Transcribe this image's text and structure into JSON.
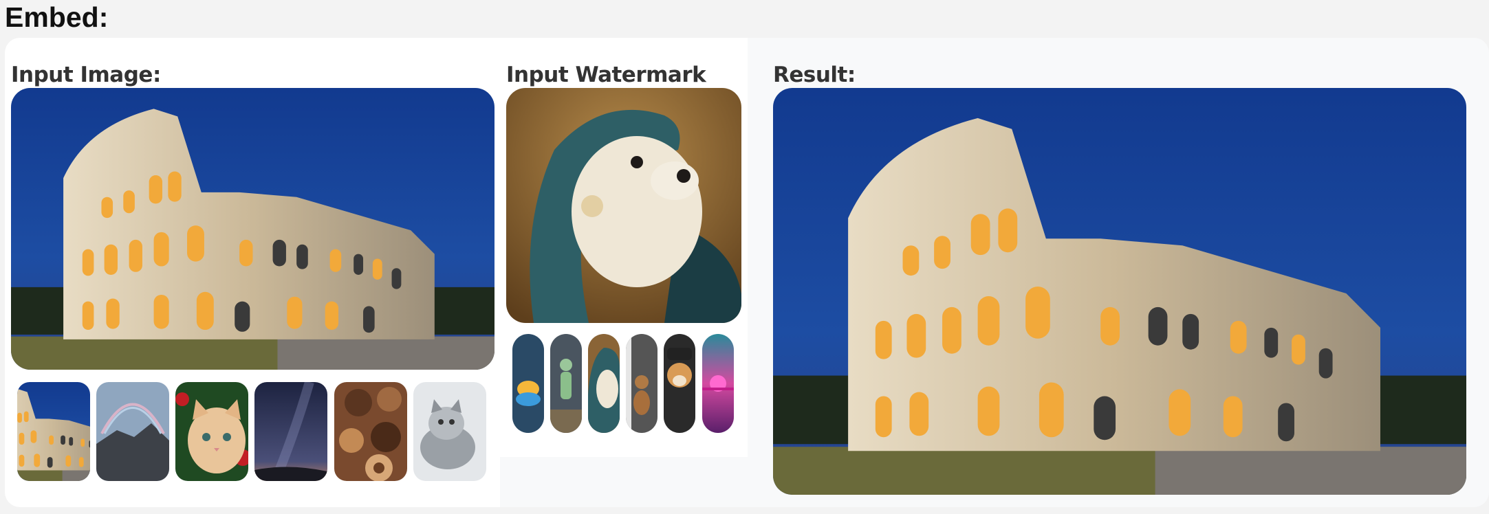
{
  "heading": "Embed:",
  "labels": {
    "input_image": "Input Image:",
    "input_watermark": "Input Watermark",
    "result": "Result:"
  },
  "example_images": [
    {
      "icon": "colosseum-thumbnail"
    },
    {
      "icon": "rainbow-mountain-thumbnail"
    },
    {
      "icon": "kitten-christmas-thumbnail"
    },
    {
      "icon": "milky-way-thumbnail"
    },
    {
      "icon": "chocolates-thumbnail"
    },
    {
      "icon": "grey-kitten-thumbnail"
    }
  ],
  "example_watermarks": [
    {
      "icon": "fish-bowl-thumbnail"
    },
    {
      "icon": "astronaut-thumbnail"
    },
    {
      "icon": "otter-thumbnail"
    },
    {
      "icon": "teddy-bear-thumbnail"
    },
    {
      "icon": "shiba-dog-thumbnail"
    },
    {
      "icon": "sunset-thumbnail"
    }
  ],
  "colors": {
    "sky": "#1a3f8a",
    "stone": "#c9b89a",
    "light": "#f4b13a",
    "grass": "#4d5a2a"
  }
}
